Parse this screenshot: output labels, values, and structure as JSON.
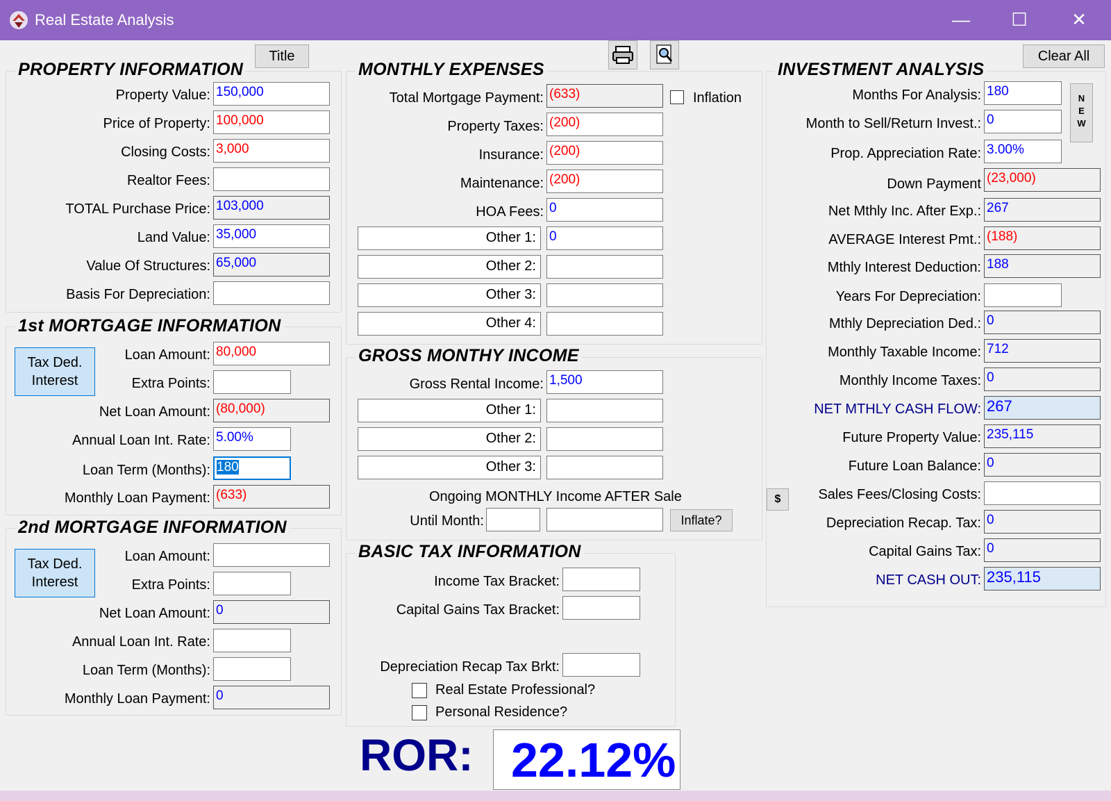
{
  "window": {
    "title": "Real Estate Analysis",
    "minimize": "—",
    "maximize": "☐",
    "close": "✕"
  },
  "toolbar": {
    "title_button": "Title",
    "clear_all": "Clear All",
    "new_button": [
      "N",
      "E",
      "W"
    ],
    "dollar_button": "$"
  },
  "property": {
    "heading": "PROPERTY INFORMATION",
    "rows": [
      {
        "label": "Property Value:",
        "value": "150,000"
      },
      {
        "label": "Price of Property:",
        "value": "100,000"
      },
      {
        "label": "Closing Costs:",
        "value": "3,000"
      },
      {
        "label": "Realtor Fees:",
        "value": ""
      },
      {
        "label": "TOTAL Purchase Price:",
        "value": "103,000"
      },
      {
        "label": "Land Value:",
        "value": "35,000"
      },
      {
        "label": "Value Of Structures:",
        "value": "65,000"
      },
      {
        "label": "Basis For Depreciation:",
        "value": ""
      }
    ]
  },
  "mortgage1": {
    "heading": "1st MORTGAGE INFORMATION",
    "tax_button": "Tax Ded.\nInterest",
    "rows": [
      {
        "label": "Loan Amount:",
        "value": "80,000"
      },
      {
        "label": "Extra Points:",
        "value": ""
      },
      {
        "label": "Net Loan Amount:",
        "value": "(80,000)"
      },
      {
        "label": "Annual Loan Int. Rate:",
        "value": "5.00%"
      },
      {
        "label": "Loan Term (Months):",
        "value": "180"
      },
      {
        "label": "Monthly Loan Payment:",
        "value": "(633)"
      }
    ]
  },
  "mortgage2": {
    "heading": "2nd MORTGAGE INFORMATION",
    "tax_button": "Tax Ded.\nInterest",
    "rows": [
      {
        "label": "Loan Amount:",
        "value": ""
      },
      {
        "label": "Extra Points:",
        "value": ""
      },
      {
        "label": "Net Loan Amount:",
        "value": "0"
      },
      {
        "label": "Annual Loan Int. Rate:",
        "value": ""
      },
      {
        "label": "Loan Term (Months):",
        "value": ""
      },
      {
        "label": "Monthly Loan Payment:",
        "value": "0"
      }
    ]
  },
  "expenses": {
    "heading": "MONTHLY EXPENSES",
    "inflation_label": "Inflation",
    "rows": [
      {
        "label": "Total Mortgage Payment:",
        "value": "(633)"
      },
      {
        "label": "Property Taxes:",
        "value": "(200)"
      },
      {
        "label": "Insurance:",
        "value": "(200)"
      },
      {
        "label": "Maintenance:",
        "value": "(200)"
      },
      {
        "label": "HOA Fees:",
        "value": "0"
      },
      {
        "label": "Other 1:",
        "value": "0"
      },
      {
        "label": "Other 2:",
        "value": ""
      },
      {
        "label": "Other 3:",
        "value": ""
      },
      {
        "label": "Other 4:",
        "value": ""
      }
    ]
  },
  "income": {
    "heading": "GROSS MONTHY INCOME",
    "rows": [
      {
        "label": "Gross Rental Income:",
        "value": "1,500"
      },
      {
        "label": "Other 1:",
        "value": ""
      },
      {
        "label": "Other 2:",
        "value": ""
      },
      {
        "label": "Other 3:",
        "value": ""
      }
    ],
    "ongoing_label": "Ongoing MONTHLY Income AFTER Sale",
    "until_label": "Until Month:",
    "inflate_button": "Inflate?"
  },
  "tax": {
    "heading": "BASIC TAX INFORMATION",
    "income_bracket": "Income Tax Bracket:",
    "capgains_bracket": "Capital Gains Tax Bracket:",
    "recap_bracket": "Depreciation Recap Tax Brkt:",
    "re_professional": "Real Estate Professional?",
    "personal_residence": "Personal Residence?"
  },
  "investment": {
    "heading": "INVESTMENT ANALYSIS",
    "rows": [
      {
        "label": "Months For Analysis:",
        "value": "180"
      },
      {
        "label": "Month to Sell/Return Invest.:",
        "value": "0"
      },
      {
        "label": "Prop. Appreciation Rate:",
        "value": "3.00%"
      },
      {
        "label": "Down Payment",
        "value": "(23,000)"
      },
      {
        "label": "Net Mthly Inc. After Exp.:",
        "value": "267"
      },
      {
        "label": "AVERAGE Interest Pmt.:",
        "value": "(188)"
      },
      {
        "label": "Mthly Interest Deduction:",
        "value": "188"
      },
      {
        "label": "Years For Depreciation:",
        "value": ""
      },
      {
        "label": "Mthly Depreciation Ded.:",
        "value": "0"
      },
      {
        "label": "Monthly Taxable Income:",
        "value": "712"
      },
      {
        "label": "Monthly Income Taxes:",
        "value": "0"
      },
      {
        "label": "NET MTHLY CASH FLOW:",
        "value": "267"
      },
      {
        "label": "Future Property Value:",
        "value": "235,115"
      },
      {
        "label": "Future Loan Balance:",
        "value": "0"
      },
      {
        "label": "Sales Fees/Closing Costs:",
        "value": ""
      },
      {
        "label": "Depreciation Recap. Tax:",
        "value": "0"
      },
      {
        "label": "Capital Gains Tax:",
        "value": "0"
      },
      {
        "label": "NET CASH OUT:",
        "value": "235,115"
      }
    ]
  },
  "ror": {
    "label": "ROR:",
    "value": "22.12%"
  }
}
